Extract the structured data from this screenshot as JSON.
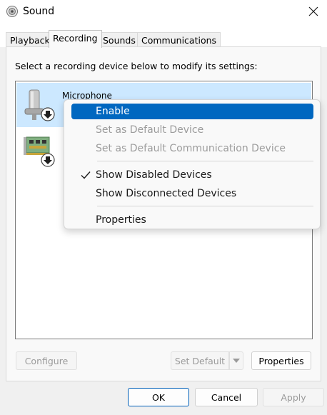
{
  "window": {
    "title": "Sound"
  },
  "tabs": [
    {
      "label": "Playback"
    },
    {
      "label": "Recording"
    },
    {
      "label": "Sounds"
    },
    {
      "label": "Communications"
    }
  ],
  "instruction": "Select a recording device below to modify its settings:",
  "devices": [
    {
      "name": "Microphone",
      "icon": "microphone-icon",
      "status_icon": "disabled-down-arrow-icon",
      "selected": true
    },
    {
      "name": "",
      "icon": "sound-card-icon",
      "status_icon": "disabled-down-arrow-icon",
      "selected": false
    }
  ],
  "context_menu": {
    "items": [
      {
        "label": "Enable",
        "enabled": true,
        "highlighted": true
      },
      {
        "label": "Set as Default Device",
        "enabled": false
      },
      {
        "label": "Set as Default Communication Device",
        "enabled": false
      },
      {
        "label": "Show Disabled Devices",
        "enabled": true,
        "checked": true
      },
      {
        "label": "Show Disconnected Devices",
        "enabled": true
      },
      {
        "label": "Properties",
        "enabled": true
      }
    ]
  },
  "buttons": {
    "configure": "Configure",
    "set_default": "Set Default",
    "properties": "Properties",
    "ok": "OK",
    "cancel": "Cancel",
    "apply": "Apply"
  },
  "colors": {
    "selection_bg": "#cce8ff",
    "menu_highlight": "#0067c0",
    "primary_border": "#005fb8"
  }
}
